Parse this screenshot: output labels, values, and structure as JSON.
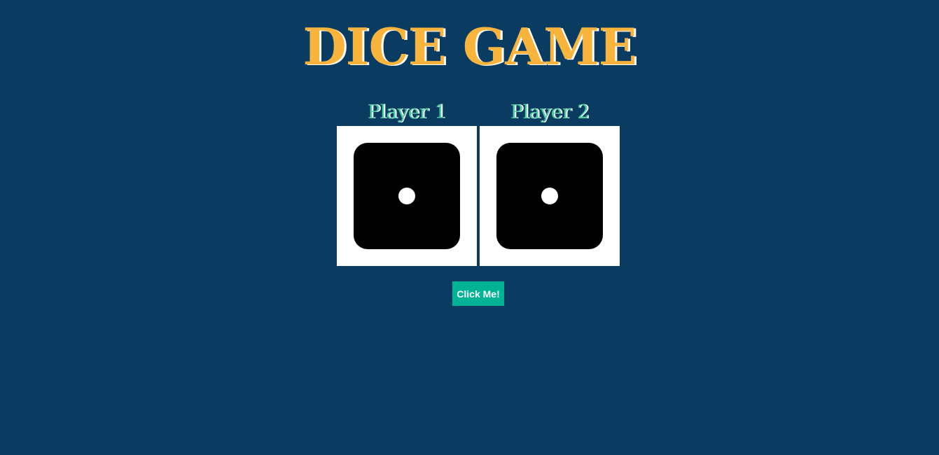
{
  "header": {
    "title": "DICE GAME"
  },
  "players": [
    {
      "label": "Player 1",
      "die_value": 1,
      "die_icon": "dice-one-icon"
    },
    {
      "label": "Player 2",
      "die_value": 1,
      "die_icon": "dice-one-icon"
    }
  ],
  "controls": {
    "roll_button_label": "Click Me!"
  },
  "colors": {
    "background": "#0a3c62",
    "title": "#f9b43e",
    "player_label": "#4ecca3",
    "button": "#00b394",
    "die": "#000000",
    "pip": "#ffffff",
    "card": "#ffffff"
  }
}
